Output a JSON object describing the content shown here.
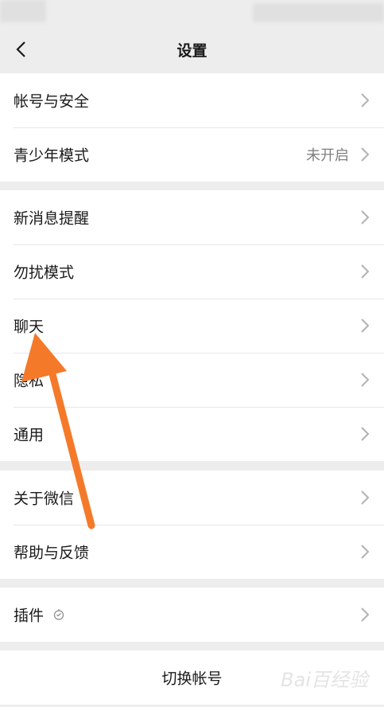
{
  "header": {
    "title": "设置"
  },
  "groups": [
    {
      "items": [
        {
          "label": "帐号与安全"
        },
        {
          "label": "青少年模式",
          "value": "未开启"
        }
      ]
    },
    {
      "items": [
        {
          "label": "新消息提醒"
        },
        {
          "label": "勿扰模式"
        },
        {
          "label": "聊天"
        },
        {
          "label": "隐私"
        },
        {
          "label": "通用"
        }
      ]
    },
    {
      "items": [
        {
          "label": "关于微信"
        },
        {
          "label": "帮助与反馈"
        }
      ]
    },
    {
      "items": [
        {
          "label": "插件"
        }
      ]
    }
  ],
  "footer": {
    "switch_account": "切换帐号"
  },
  "watermark": "Bai百经验",
  "icons": {
    "back": "chevron-left-icon",
    "row": "chevron-right-icon",
    "plugin": "plugin-icon",
    "annotation": "orange-arrow-annotation"
  },
  "colors": {
    "background": "#ededed",
    "annotation": "#f47a2a",
    "secondary_text": "#7f7f7f"
  }
}
